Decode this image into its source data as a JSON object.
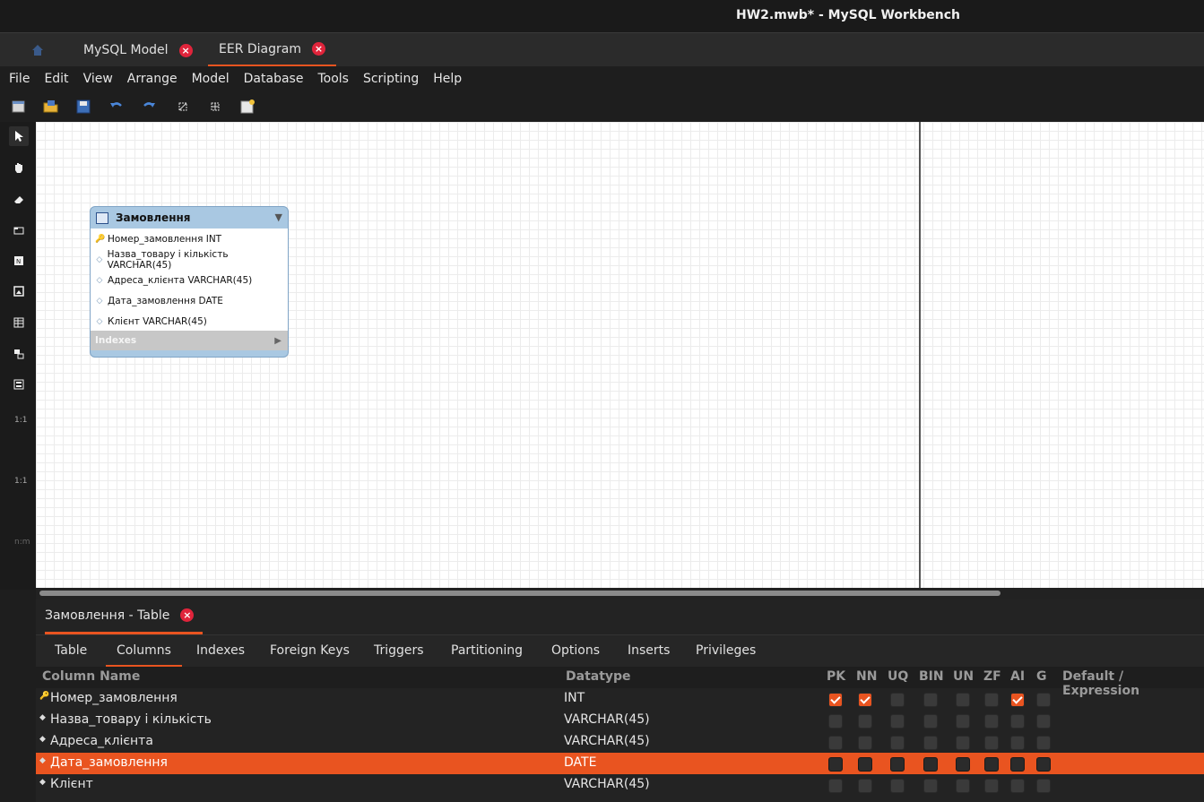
{
  "window": {
    "title": "HW2.mwb* - MySQL Workbench"
  },
  "tabs": [
    {
      "label": "MySQL Model",
      "close": "×"
    },
    {
      "label": "EER Diagram",
      "close": "×"
    }
  ],
  "menu": [
    "File",
    "Edit",
    "View",
    "Arrange",
    "Model",
    "Database",
    "Tools",
    "Scripting",
    "Help"
  ],
  "toolbar": [
    "new-document-icon",
    "open-folder-icon",
    "save-icon",
    "undo-icon",
    "redo-icon",
    "toggle-grid-icon",
    "align-grid-icon",
    "new-diagram-icon"
  ],
  "palette": {
    "ratio_a": "1:1",
    "ratio_b": "1:1",
    "ratio_c": "n:m"
  },
  "entity": {
    "name": "Замовлення",
    "columns": [
      {
        "text": "Номер_замовлення INT",
        "icon": "key-icon"
      },
      {
        "text": "Назва_товару і кількість VARCHAR(45)",
        "icon": "diamond-icon"
      },
      {
        "text": "Адреса_клієнта VARCHAR(45)",
        "icon": "diamond-icon"
      },
      {
        "text": "Дата_замовлення DATE",
        "icon": "diamond-icon"
      },
      {
        "text": "Клієнт VARCHAR(45)",
        "icon": "diamond-icon"
      }
    ],
    "indexes_label": "Indexes"
  },
  "editor": {
    "tab_label": "Замовлення - Table",
    "close": "×",
    "subtabs": [
      "Table",
      "Columns",
      "Indexes",
      "Foreign Keys",
      "Triggers",
      "Partitioning",
      "Options",
      "Inserts",
      "Privileges"
    ],
    "active_subtab": "Columns",
    "headers": {
      "name": "Column Name",
      "type": "Datatype",
      "pk": "PK",
      "nn": "NN",
      "uq": "UQ",
      "bin": "BIN",
      "un": "UN",
      "zf": "ZF",
      "ai": "AI",
      "g": "G",
      "default": "Default / Expression"
    },
    "rows": [
      {
        "name": "Номер_замовлення",
        "type": "INT",
        "icon": "key-icon",
        "pk": true,
        "nn": true,
        "uq": false,
        "bin": false,
        "un": false,
        "zf": false,
        "ai": true,
        "g": false
      },
      {
        "name": "Назва_товару і кількість",
        "type": "VARCHAR(45)",
        "icon": "diamond-icon",
        "pk": false,
        "nn": false,
        "uq": false,
        "bin": false,
        "un": false,
        "zf": false,
        "ai": false,
        "g": false
      },
      {
        "name": "Адреса_клієнта",
        "type": "VARCHAR(45)",
        "icon": "diamond-icon",
        "pk": false,
        "nn": false,
        "uq": false,
        "bin": false,
        "un": false,
        "zf": false,
        "ai": false,
        "g": false
      },
      {
        "name": "Дата_замовлення",
        "type": "DATE",
        "icon": "diamond-icon",
        "selected": true,
        "pk": false,
        "nn": false,
        "uq": false,
        "bin": false,
        "un": false,
        "zf": false,
        "ai": false,
        "g": false
      },
      {
        "name": "Клієнт",
        "type": "VARCHAR(45)",
        "icon": "diamond-icon",
        "pk": false,
        "nn": false,
        "uq": false,
        "bin": false,
        "un": false,
        "zf": false,
        "ai": false,
        "g": false
      }
    ]
  }
}
